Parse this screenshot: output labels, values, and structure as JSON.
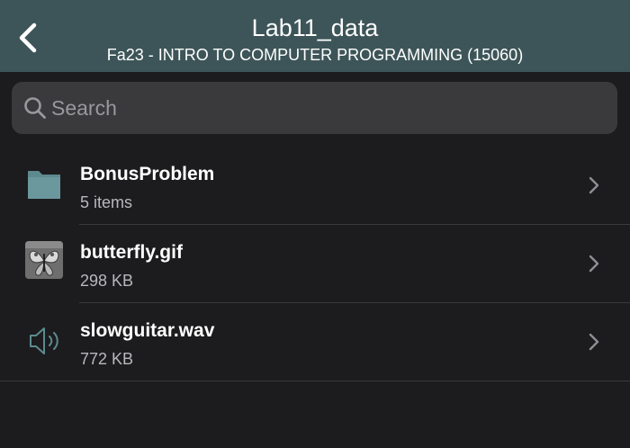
{
  "header": {
    "title": "Lab11_data",
    "subtitle": "Fa23 - INTRO TO COMPUTER PROGRAMMING (15060)",
    "back_icon": "chevron-left-icon",
    "background_color": "#3d5558"
  },
  "search": {
    "placeholder": "Search",
    "value": "",
    "icon": "search-icon"
  },
  "files": [
    {
      "name": "BonusProblem",
      "meta": "5 items",
      "icon": "folder-icon",
      "icon_color": "#5d8a8f"
    },
    {
      "name": "butterfly.gif",
      "meta": "298 KB",
      "icon": "image-thumbnail-icon"
    },
    {
      "name": "slowguitar.wav",
      "meta": "772 KB",
      "icon": "speaker-icon",
      "icon_color": "#5d8a8f"
    }
  ],
  "colors": {
    "background": "#1c1c1e",
    "search_background": "#3a3a3c",
    "secondary_text": "#b8b8bd",
    "accent": "#5d8a8f"
  }
}
